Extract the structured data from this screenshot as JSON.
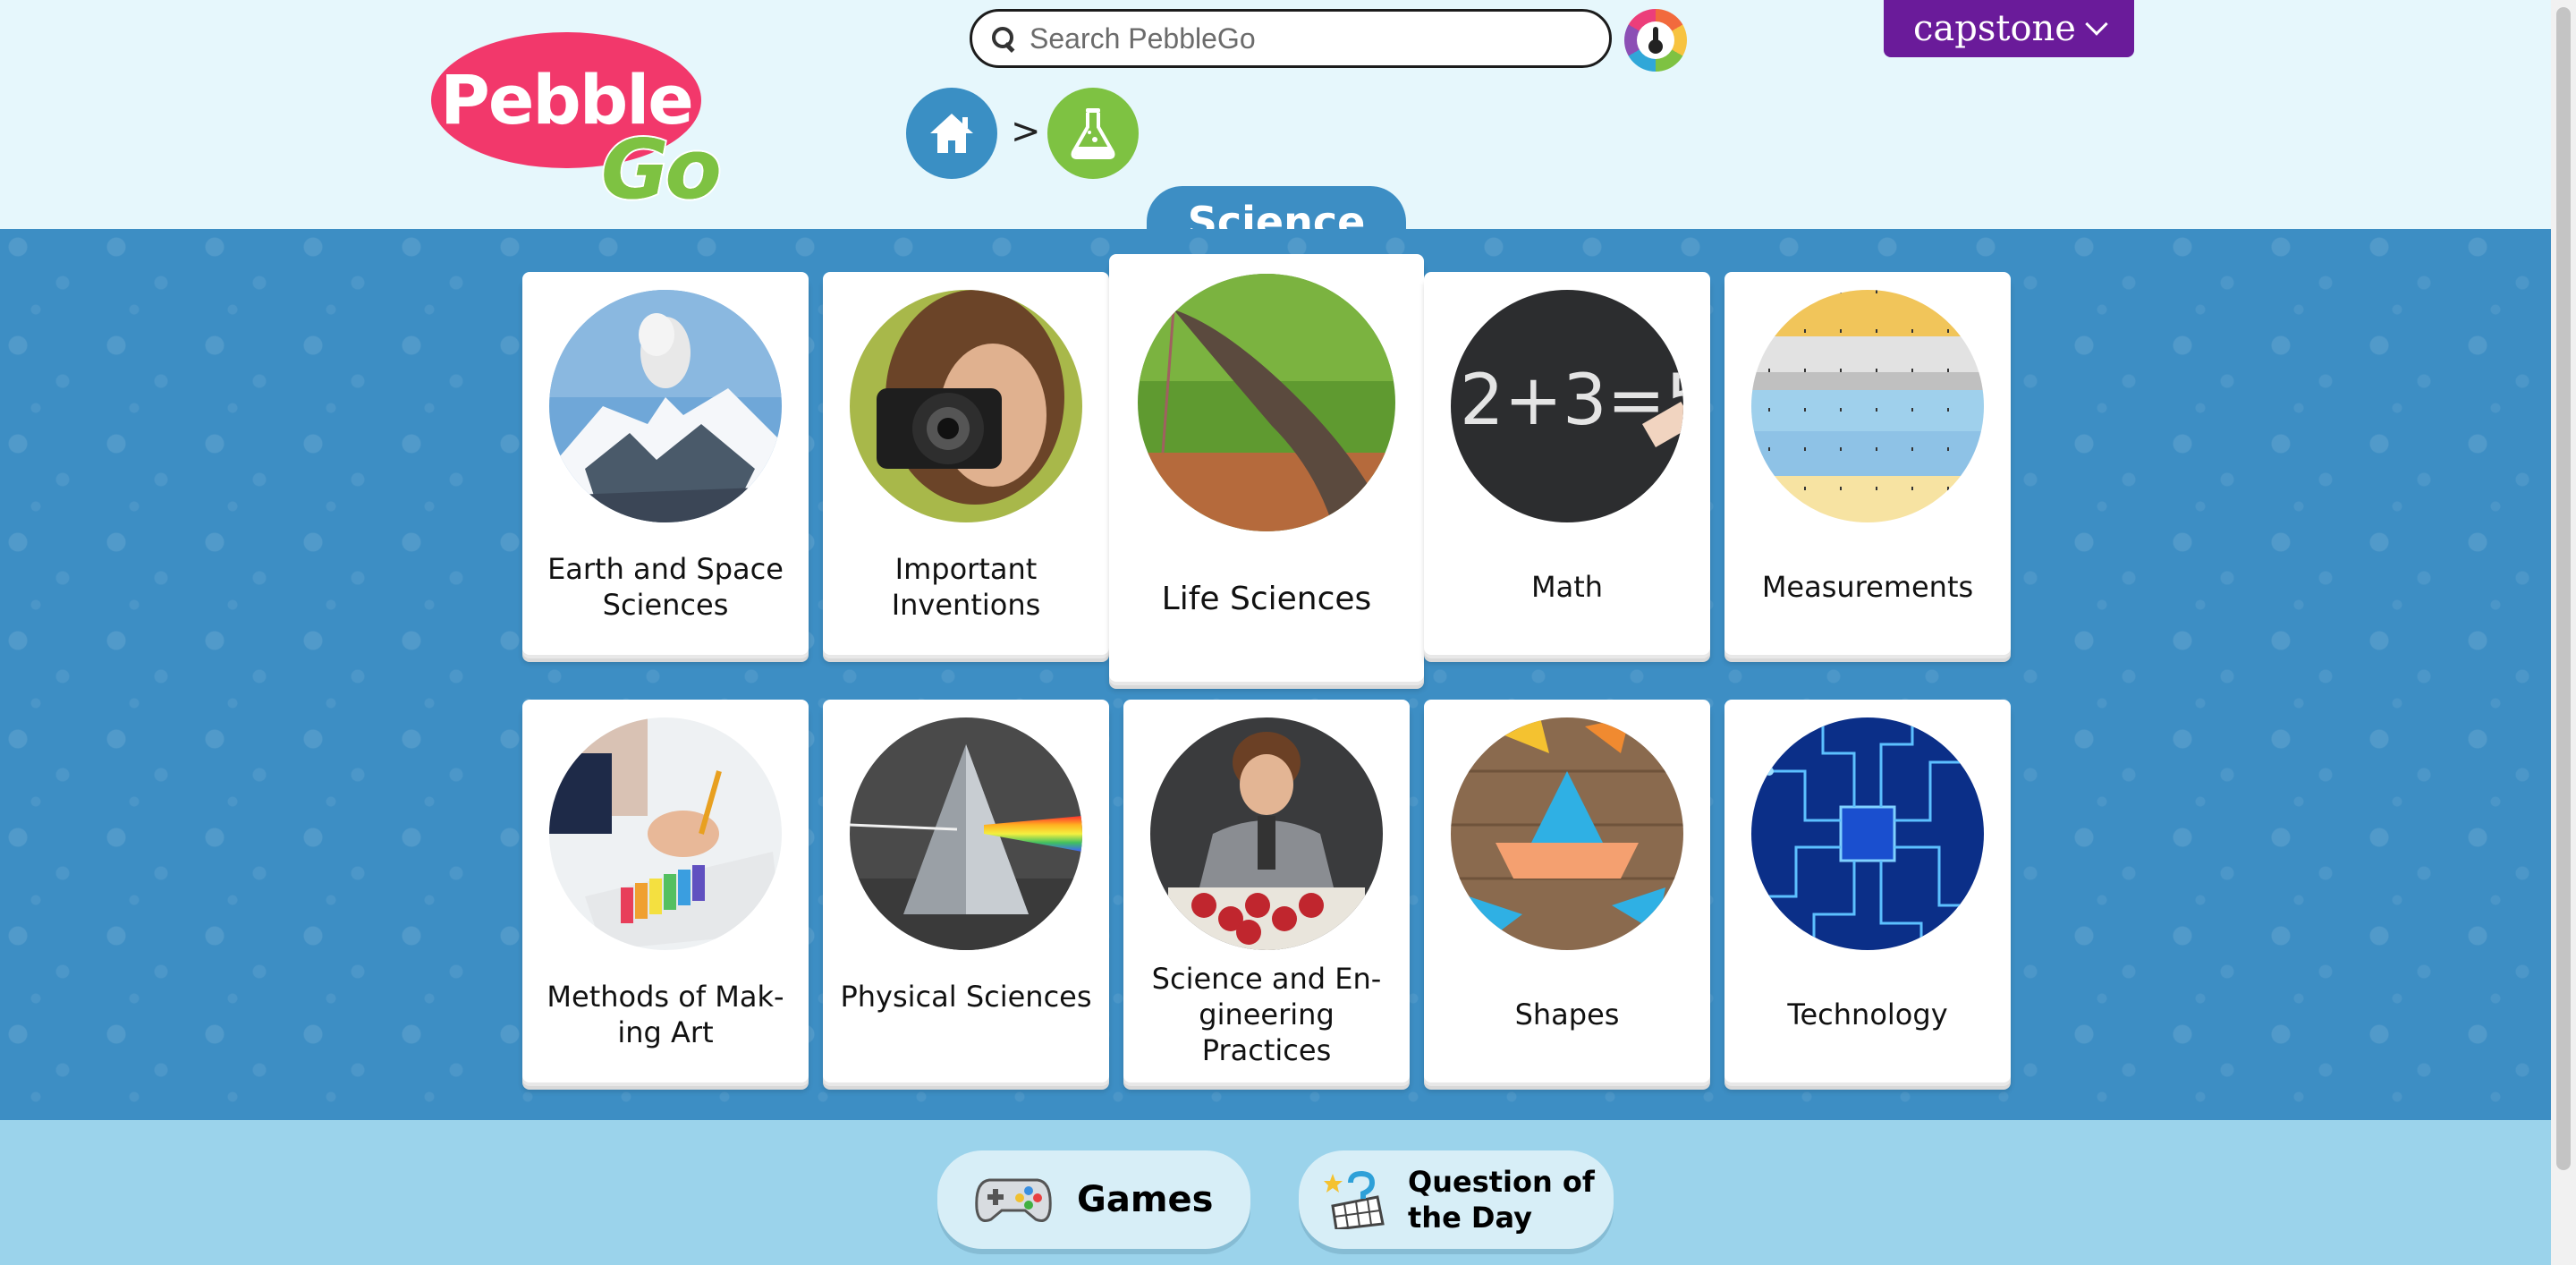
{
  "header": {
    "logo_text_top": "Pebble",
    "logo_text_bottom": "Go",
    "search_placeholder": "Search PebbleGo",
    "brand_menu_label": "capstone"
  },
  "breadcrumb": {
    "separator": ">",
    "items": [
      "home-icon",
      "flask-icon"
    ]
  },
  "section": {
    "title": "Science"
  },
  "cards": [
    {
      "label": "Earth and Space Sciences",
      "image": "volcano-photo"
    },
    {
      "label": "Important Inventions",
      "image": "camera-photo"
    },
    {
      "label": "Life Sciences",
      "image": "anteater-photo"
    },
    {
      "label": "Math",
      "image": "chalkboard-equation-photo"
    },
    {
      "label": "Measurements",
      "image": "rulers-photo"
    },
    {
      "label": "Methods of Mak-ing Art",
      "image": "painting-photo"
    },
    {
      "label": "Physical Sciences",
      "image": "prism-photo"
    },
    {
      "label": "Science and En-gineering Practices",
      "image": "boy-puzzle-photo"
    },
    {
      "label": "Shapes",
      "image": "tangram-boat-photo"
    },
    {
      "label": "Technology",
      "image": "circuit-board-photo"
    }
  ],
  "footer": {
    "games_label": "Games",
    "qotd_line1": "Question of",
    "qotd_line2": "the Day"
  },
  "colors": {
    "main_blue": "#3d8ec4",
    "header_bg": "#e6f7fc",
    "logo_pink": "#f2386b",
    "logo_green": "#7ec242",
    "capstone_purple": "#6a1b9a",
    "footer_bg": "#9bd3eb"
  }
}
